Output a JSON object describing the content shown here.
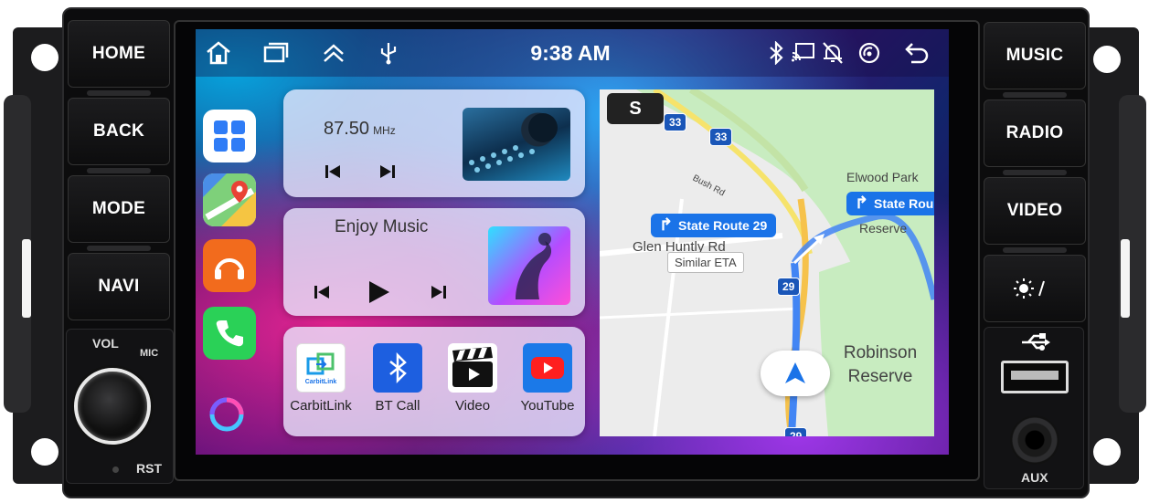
{
  "hardware": {
    "left_buttons": [
      "HOME",
      "BACK",
      "MODE",
      "NAVI"
    ],
    "right_buttons": [
      "MUSIC",
      "RADIO",
      "VIDEO"
    ],
    "vol_label": "VOL",
    "mic_label": "MIC",
    "rst_label": "RST",
    "aux_label": "AUX"
  },
  "status_bar": {
    "time": "9:38 AM",
    "left_icons": [
      "home-icon",
      "recent-apps-icon",
      "chevron-up-icon",
      "usb-icon"
    ],
    "right_icons": [
      "bluetooth-icon",
      "screen-cast-icon",
      "mute-icon",
      "signal-icon",
      "back-icon"
    ]
  },
  "dock": {
    "apps": [
      "apps-grid-icon",
      "maps-icon",
      "music-app-icon",
      "phone-icon",
      "assistant-icon"
    ]
  },
  "radio_card": {
    "frequency": "87.50",
    "unit": "MHz"
  },
  "music_card": {
    "title": "Enjoy Music"
  },
  "apps_card": {
    "apps": [
      {
        "label": "CarbitLink",
        "icon": "carbitlink-icon",
        "badge": "CarbitLink"
      },
      {
        "label": "BT Call",
        "icon": "bluetooth-icon"
      },
      {
        "label": "Video",
        "icon": "clapperboard-icon"
      },
      {
        "label": "YouTube",
        "icon": "youtube-icon"
      }
    ]
  },
  "map": {
    "search_letter": "S",
    "chip_main": "State Route 29",
    "chip_alt": "State Rou",
    "similar_eta": "Similar ETA",
    "place_1": "Elwood Park",
    "place_1b": "Reserve",
    "place_2_line1": "Robinson",
    "place_2_line2": "Reserve",
    "road_1": "Glen Huntly Rd",
    "road_2": "Bush Rd",
    "shield_a": "33",
    "shield_b": "33",
    "shield_c": "29",
    "shield_d": "29"
  },
  "colors": {
    "accent_blue": "#1a73e8",
    "route_blue": "#4285f4",
    "park_green": "#c8ecc0"
  }
}
